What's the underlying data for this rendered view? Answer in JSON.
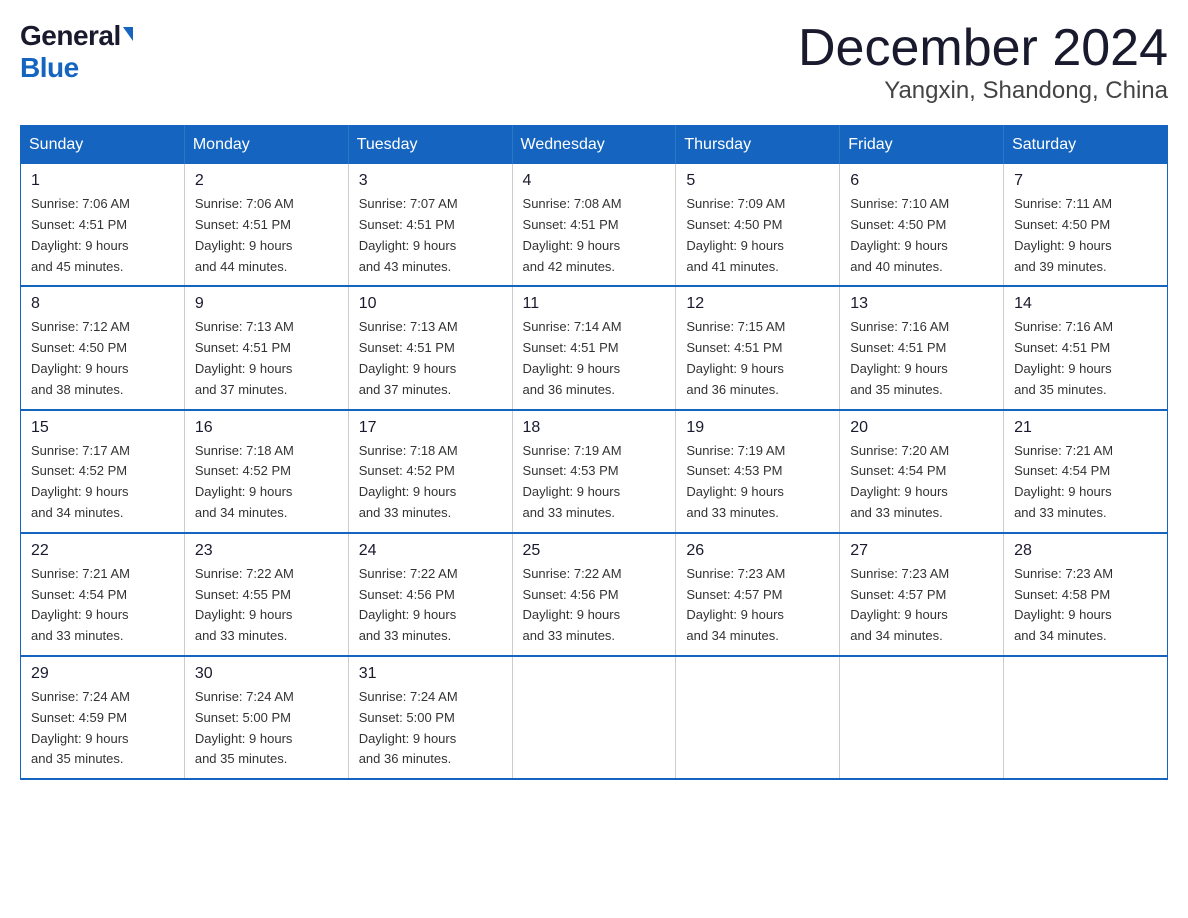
{
  "header": {
    "logo": {
      "general": "General",
      "blue": "Blue"
    },
    "title": "December 2024",
    "location": "Yangxin, Shandong, China"
  },
  "days_of_week": [
    "Sunday",
    "Monday",
    "Tuesday",
    "Wednesday",
    "Thursday",
    "Friday",
    "Saturday"
  ],
  "weeks": [
    [
      {
        "day": "1",
        "sunrise": "7:06 AM",
        "sunset": "4:51 PM",
        "daylight": "9 hours and 45 minutes."
      },
      {
        "day": "2",
        "sunrise": "7:06 AM",
        "sunset": "4:51 PM",
        "daylight": "9 hours and 44 minutes."
      },
      {
        "day": "3",
        "sunrise": "7:07 AM",
        "sunset": "4:51 PM",
        "daylight": "9 hours and 43 minutes."
      },
      {
        "day": "4",
        "sunrise": "7:08 AM",
        "sunset": "4:51 PM",
        "daylight": "9 hours and 42 minutes."
      },
      {
        "day": "5",
        "sunrise": "7:09 AM",
        "sunset": "4:50 PM",
        "daylight": "9 hours and 41 minutes."
      },
      {
        "day": "6",
        "sunrise": "7:10 AM",
        "sunset": "4:50 PM",
        "daylight": "9 hours and 40 minutes."
      },
      {
        "day": "7",
        "sunrise": "7:11 AM",
        "sunset": "4:50 PM",
        "daylight": "9 hours and 39 minutes."
      }
    ],
    [
      {
        "day": "8",
        "sunrise": "7:12 AM",
        "sunset": "4:50 PM",
        "daylight": "9 hours and 38 minutes."
      },
      {
        "day": "9",
        "sunrise": "7:13 AM",
        "sunset": "4:51 PM",
        "daylight": "9 hours and 37 minutes."
      },
      {
        "day": "10",
        "sunrise": "7:13 AM",
        "sunset": "4:51 PM",
        "daylight": "9 hours and 37 minutes."
      },
      {
        "day": "11",
        "sunrise": "7:14 AM",
        "sunset": "4:51 PM",
        "daylight": "9 hours and 36 minutes."
      },
      {
        "day": "12",
        "sunrise": "7:15 AM",
        "sunset": "4:51 PM",
        "daylight": "9 hours and 36 minutes."
      },
      {
        "day": "13",
        "sunrise": "7:16 AM",
        "sunset": "4:51 PM",
        "daylight": "9 hours and 35 minutes."
      },
      {
        "day": "14",
        "sunrise": "7:16 AM",
        "sunset": "4:51 PM",
        "daylight": "9 hours and 35 minutes."
      }
    ],
    [
      {
        "day": "15",
        "sunrise": "7:17 AM",
        "sunset": "4:52 PM",
        "daylight": "9 hours and 34 minutes."
      },
      {
        "day": "16",
        "sunrise": "7:18 AM",
        "sunset": "4:52 PM",
        "daylight": "9 hours and 34 minutes."
      },
      {
        "day": "17",
        "sunrise": "7:18 AM",
        "sunset": "4:52 PM",
        "daylight": "9 hours and 33 minutes."
      },
      {
        "day": "18",
        "sunrise": "7:19 AM",
        "sunset": "4:53 PM",
        "daylight": "9 hours and 33 minutes."
      },
      {
        "day": "19",
        "sunrise": "7:19 AM",
        "sunset": "4:53 PM",
        "daylight": "9 hours and 33 minutes."
      },
      {
        "day": "20",
        "sunrise": "7:20 AM",
        "sunset": "4:54 PM",
        "daylight": "9 hours and 33 minutes."
      },
      {
        "day": "21",
        "sunrise": "7:21 AM",
        "sunset": "4:54 PM",
        "daylight": "9 hours and 33 minutes."
      }
    ],
    [
      {
        "day": "22",
        "sunrise": "7:21 AM",
        "sunset": "4:54 PM",
        "daylight": "9 hours and 33 minutes."
      },
      {
        "day": "23",
        "sunrise": "7:22 AM",
        "sunset": "4:55 PM",
        "daylight": "9 hours and 33 minutes."
      },
      {
        "day": "24",
        "sunrise": "7:22 AM",
        "sunset": "4:56 PM",
        "daylight": "9 hours and 33 minutes."
      },
      {
        "day": "25",
        "sunrise": "7:22 AM",
        "sunset": "4:56 PM",
        "daylight": "9 hours and 33 minutes."
      },
      {
        "day": "26",
        "sunrise": "7:23 AM",
        "sunset": "4:57 PM",
        "daylight": "9 hours and 34 minutes."
      },
      {
        "day": "27",
        "sunrise": "7:23 AM",
        "sunset": "4:57 PM",
        "daylight": "9 hours and 34 minutes."
      },
      {
        "day": "28",
        "sunrise": "7:23 AM",
        "sunset": "4:58 PM",
        "daylight": "9 hours and 34 minutes."
      }
    ],
    [
      {
        "day": "29",
        "sunrise": "7:24 AM",
        "sunset": "4:59 PM",
        "daylight": "9 hours and 35 minutes."
      },
      {
        "day": "30",
        "sunrise": "7:24 AM",
        "sunset": "5:00 PM",
        "daylight": "9 hours and 35 minutes."
      },
      {
        "day": "31",
        "sunrise": "7:24 AM",
        "sunset": "5:00 PM",
        "daylight": "9 hours and 36 minutes."
      },
      null,
      null,
      null,
      null
    ]
  ],
  "labels": {
    "sunrise": "Sunrise:",
    "sunset": "Sunset:",
    "daylight": "Daylight:"
  }
}
